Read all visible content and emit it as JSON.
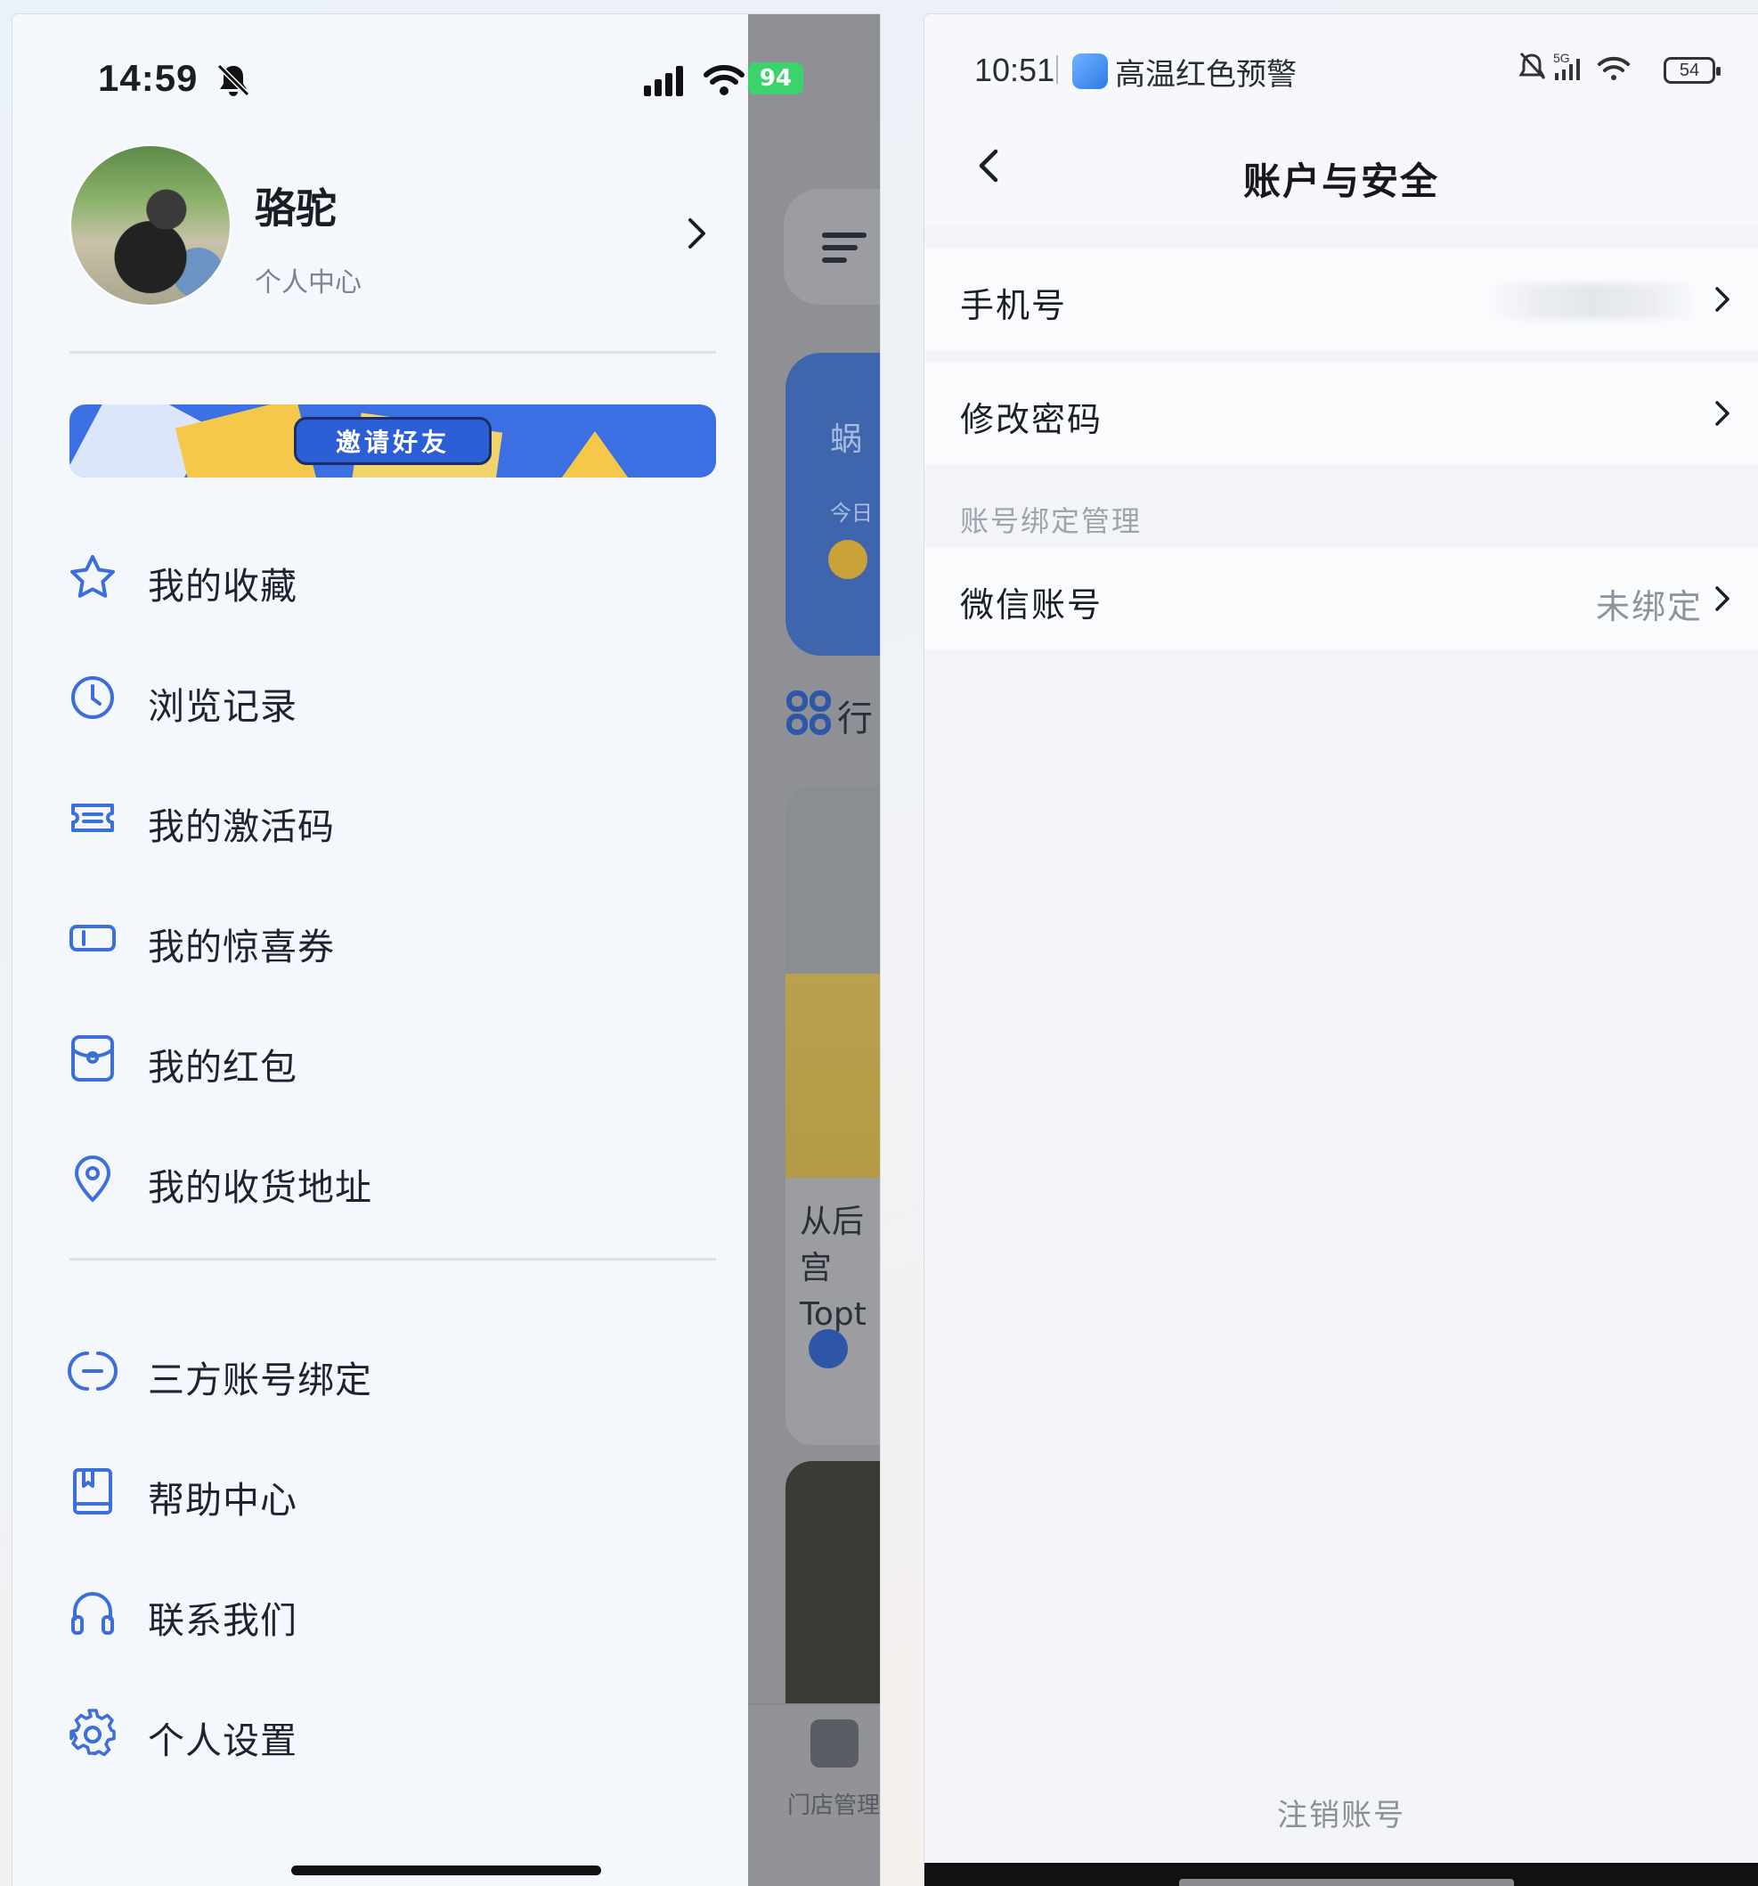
{
  "left_phone": {
    "status_bar": {
      "time": "14:59",
      "battery": "94"
    },
    "profile": {
      "name": "骆驼",
      "subtitle": "个人中心"
    },
    "invite_banner": {
      "label": "邀请好友"
    },
    "menu_primary": [
      {
        "label": "我的收藏",
        "icon": "star-icon"
      },
      {
        "label": "浏览记录",
        "icon": "clock-icon"
      },
      {
        "label": "我的激活码",
        "icon": "ticket-icon"
      },
      {
        "label": "我的惊喜券",
        "icon": "coupon-icon"
      },
      {
        "label": "我的红包",
        "icon": "red-envelope-icon"
      },
      {
        "label": "我的收货地址",
        "icon": "location-pin-icon"
      }
    ],
    "menu_secondary": [
      {
        "label": "三方账号绑定",
        "icon": "link-icon"
      },
      {
        "label": "帮助中心",
        "icon": "book-icon"
      },
      {
        "label": "联系我们",
        "icon": "headset-icon"
      },
      {
        "label": "个人设置",
        "icon": "gear-icon"
      }
    ],
    "background_page": {
      "card_title": "蜗",
      "card_sub": "今日",
      "section_title": "行",
      "article_title": "从后宫 Topt",
      "tab_label": "门店管理"
    }
  },
  "right_phone": {
    "status_bar": {
      "time": "10:51",
      "alert": "高温红色预警",
      "network": "5G",
      "battery": "54"
    },
    "header": {
      "title": "账户与安全"
    },
    "rows": [
      {
        "label": "手机号",
        "value": ""
      },
      {
        "label": "修改密码",
        "value": ""
      }
    ],
    "section_label": "账号绑定管理",
    "wechat_row": {
      "label": "微信账号",
      "value": "未绑定"
    },
    "footer": {
      "deactivate": "注销账号"
    }
  },
  "colors": {
    "accent": "#3b6fe2",
    "icon_blue": "#3d6fd8",
    "drawer_bg": "#f4f7fc",
    "overlay": "#8e9095"
  }
}
